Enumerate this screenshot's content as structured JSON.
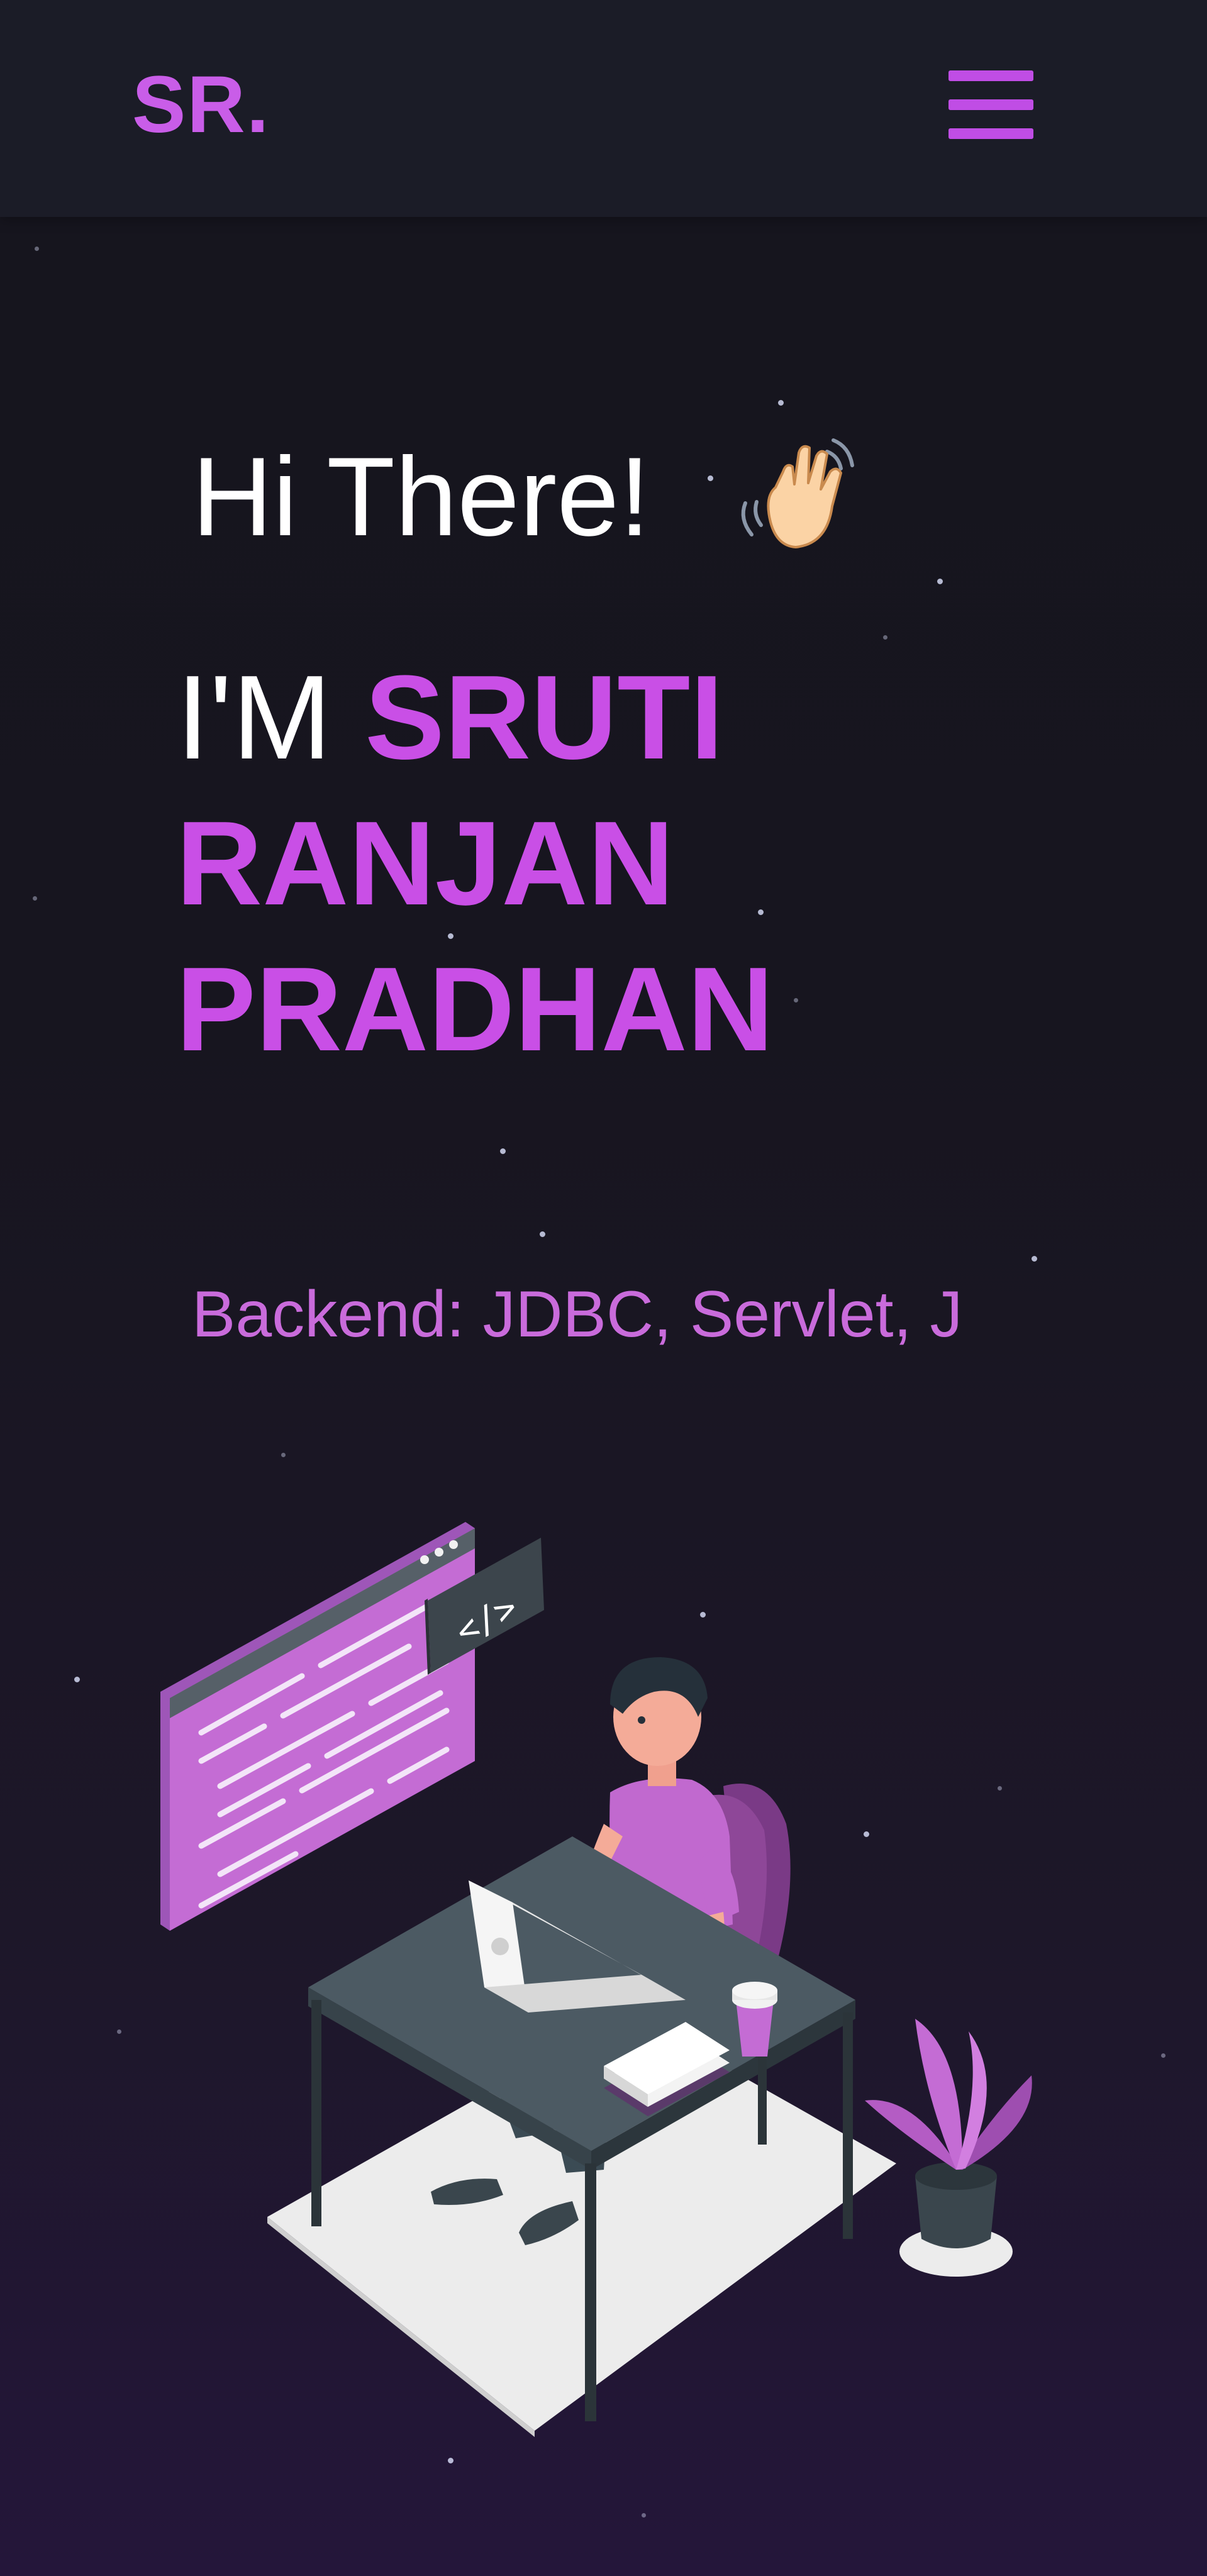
{
  "header": {
    "logo": "SR.",
    "menu_icon": "hamburger-menu-icon"
  },
  "hero": {
    "greeting": "Hi There!",
    "greeting_icon": "waving-hand-icon",
    "intro_prefix": "I'M",
    "name_line1": "SRUTI",
    "name_line2": "RANJAN",
    "name_line3": "PRADHAN",
    "typewriter_text": "Backend: JDBC, Servlet, J",
    "illustration_icon": "developer-at-desk-illustration"
  },
  "colors": {
    "accent": "#c94fe6",
    "background": "#16151e",
    "navbar": "#1b1c27",
    "text": "#ffffff"
  }
}
